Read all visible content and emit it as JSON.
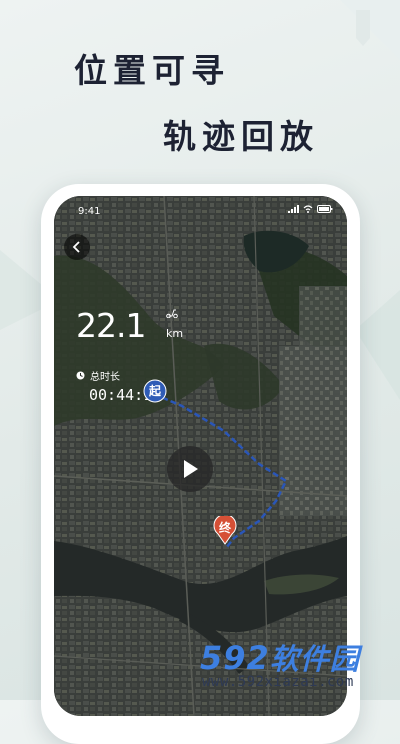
{
  "headline": {
    "line1": "位置可寻",
    "line2": "轨迹回放"
  },
  "status_bar": {
    "time": "9:41"
  },
  "stats": {
    "distance_value": "22.1",
    "distance_unit": "km",
    "duration_label": "总时长",
    "duration_value": "00:44:15"
  },
  "markers": {
    "start": "起",
    "end": "终"
  },
  "watermark": {
    "logo_digits": "592",
    "logo_text": "软件园",
    "url": "www.592xiazai.com"
  },
  "colors": {
    "route": "#2a56b8",
    "start_marker": "#2f5cb6",
    "end_marker": "#d65036",
    "headline": "#1d2233",
    "watermark": "#3d7fe0"
  },
  "icons": [
    "back-arrow-icon",
    "scooter-icon",
    "clock-icon",
    "play-icon",
    "signal-icon",
    "wifi-icon",
    "battery-icon"
  ]
}
